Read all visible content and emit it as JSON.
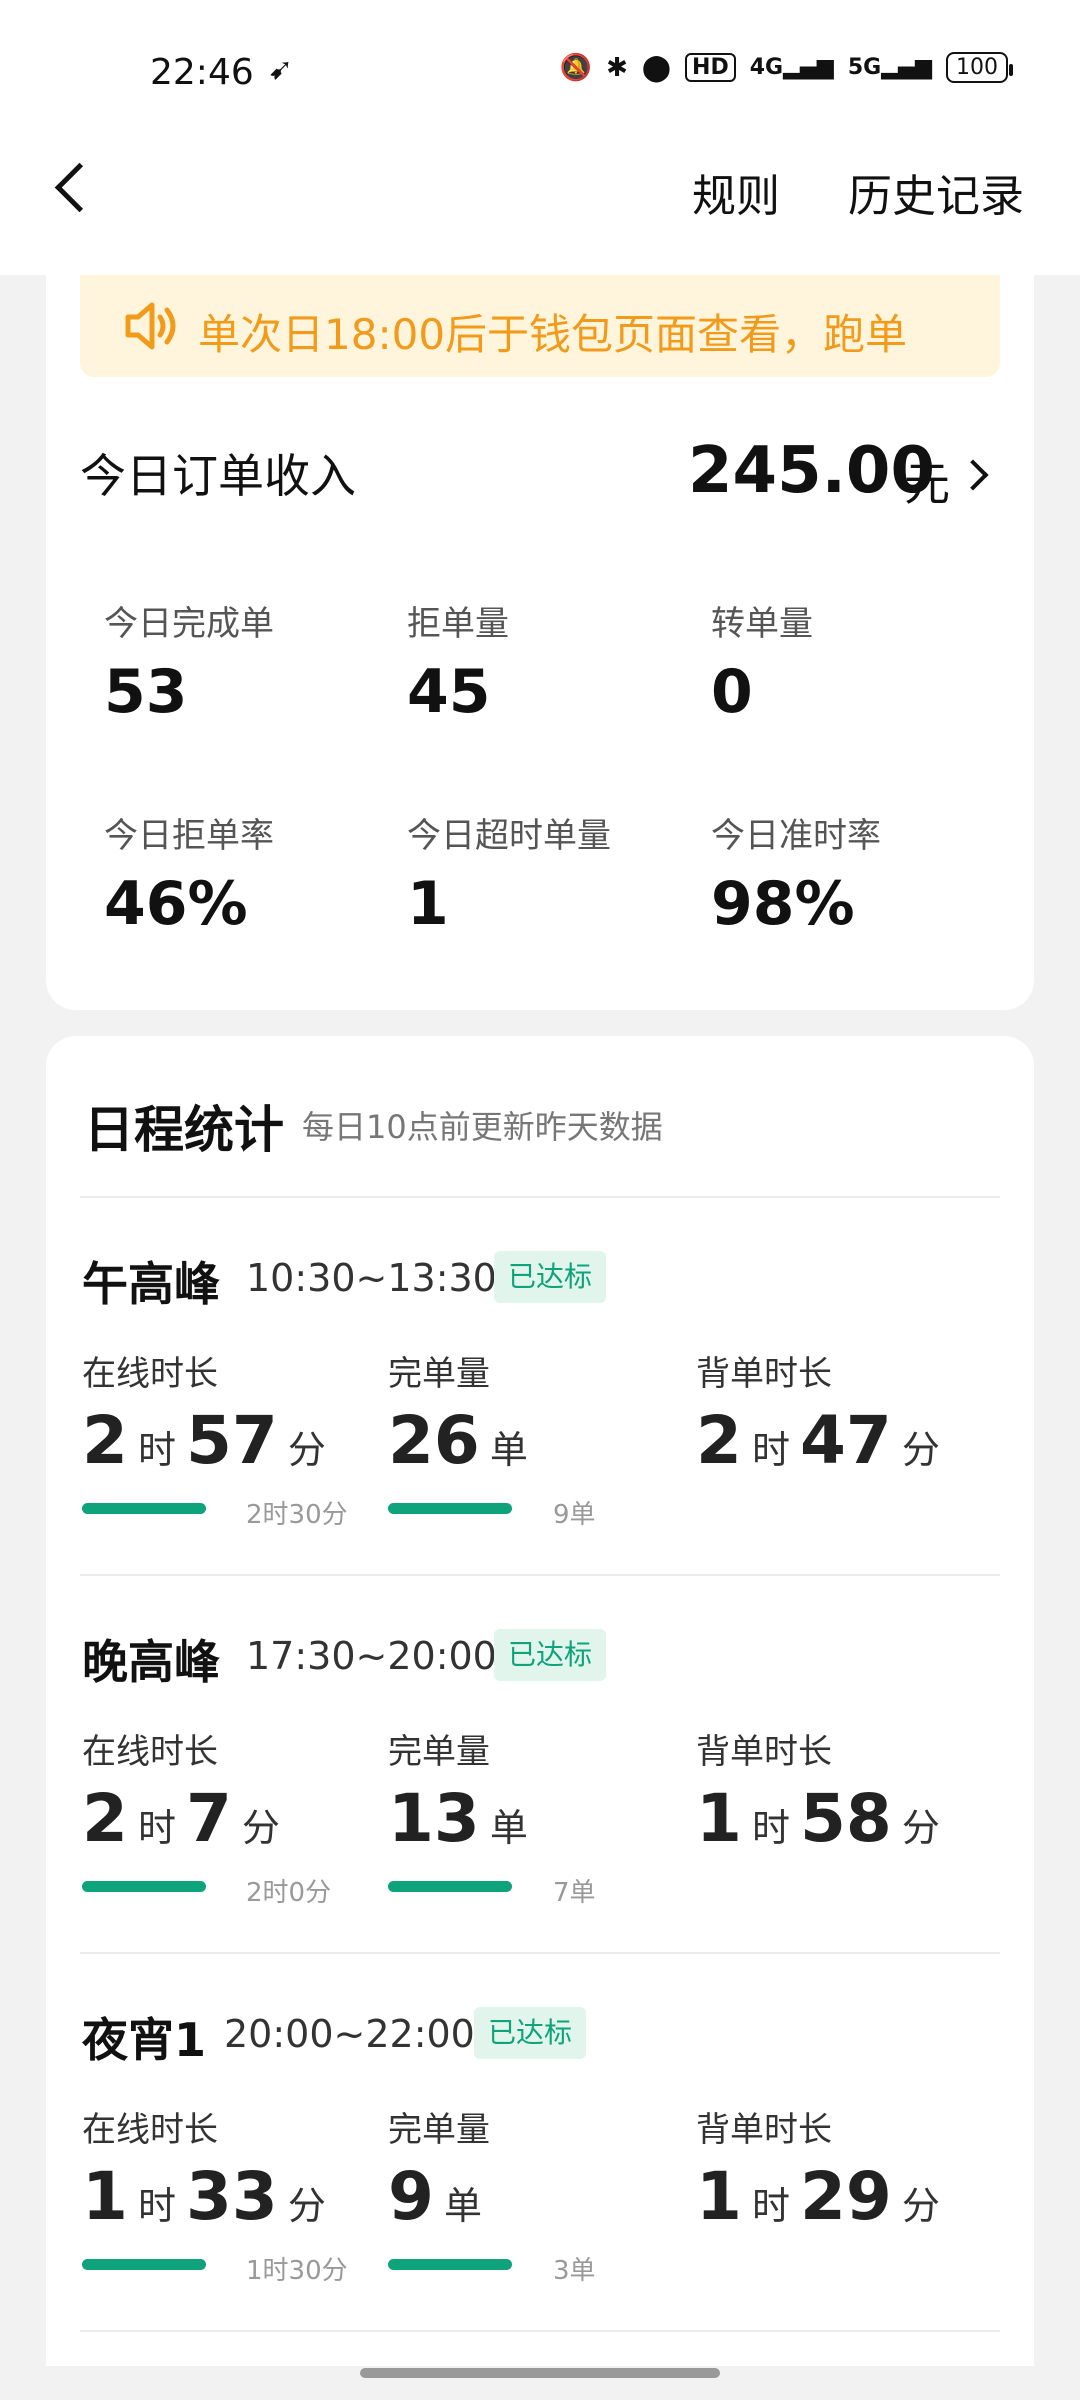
{
  "statusbar": {
    "time": "22:46",
    "battery": "100",
    "net1": "4G",
    "net2": "5G",
    "hd": "HD"
  },
  "topbar": {
    "rules": "规则",
    "history": "历史记录"
  },
  "notice": {
    "text": "单次日18:00后于钱包页面查看，跑单"
  },
  "income": {
    "label": "今日订单收入",
    "value": "245.00",
    "unit": "元"
  },
  "stats": [
    {
      "label": "今日完成单",
      "value": "53"
    },
    {
      "label": "拒单量",
      "value": "45"
    },
    {
      "label": "转单量",
      "value": "0"
    },
    {
      "label": "今日拒单率",
      "value": "46%"
    },
    {
      "label": "今日超时单量",
      "value": "1"
    },
    {
      "label": "今日准时率",
      "value": "98%"
    }
  ],
  "schedule": {
    "title": "日程统计",
    "subtitle": "每日10点前更新昨天数据",
    "col_labels": {
      "online": "在线时长",
      "orders": "完单量",
      "back": "背单时长"
    },
    "units": {
      "hour": "时",
      "minute": "分",
      "order": "单"
    },
    "periods": [
      {
        "name": "午高峰",
        "time": "10:30~13:30",
        "badge": "已达标",
        "online_h": "2",
        "online_m": "57",
        "online_target": "2时30分",
        "orders": "26",
        "orders_target": "9单",
        "back_h": "2",
        "back_m": "47"
      },
      {
        "name": "晚高峰",
        "time": "17:30~20:00",
        "badge": "已达标",
        "online_h": "2",
        "online_m": "7",
        "online_target": "2时0分",
        "orders": "13",
        "orders_target": "7单",
        "back_h": "1",
        "back_m": "58"
      },
      {
        "name": "夜宵1",
        "time": "20:00~22:00",
        "badge": "已达标",
        "online_h": "1",
        "online_m": "33",
        "online_target": "1时30分",
        "orders": "9",
        "orders_target": "3单",
        "back_h": "1",
        "back_m": "29"
      }
    ]
  }
}
